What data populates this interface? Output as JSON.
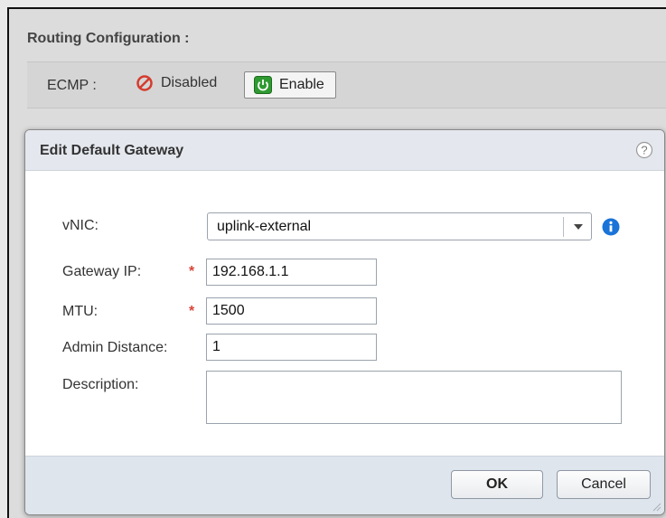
{
  "background": {
    "section_title": "Routing Configuration :",
    "ecmp": {
      "label": "ECMP :",
      "status": "Disabled",
      "enable_label": "Enable"
    }
  },
  "dialog": {
    "title": "Edit Default Gateway",
    "fields": {
      "vnic": {
        "label": "vNIC:",
        "value": "uplink-external"
      },
      "gateway_ip": {
        "label": "Gateway IP:",
        "value": "192.168.1.1",
        "required": true
      },
      "mtu": {
        "label": "MTU:",
        "value": "1500",
        "required": true
      },
      "admin_distance": {
        "label": "Admin Distance:",
        "value": "1"
      },
      "description": {
        "label": "Description:",
        "value": ""
      }
    },
    "buttons": {
      "ok": "OK",
      "cancel": "Cancel"
    }
  },
  "icons": {
    "disabled": "disabled-icon",
    "enable": "power-icon",
    "help": "help-icon",
    "info": "info-icon",
    "dropdown": "chevron-down-icon",
    "required": "required-asterisk-icon"
  },
  "colors": {
    "required": "#d9443a",
    "info": "#1a73d8",
    "enable": "#2f9a31",
    "disabled": "#d53a2e"
  }
}
